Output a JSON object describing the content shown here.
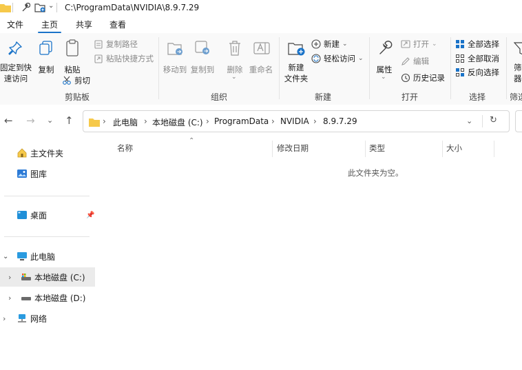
{
  "window": {
    "title": "C:\\ProgramData\\NVIDIA\\8.9.7.29"
  },
  "tabs": [
    {
      "label": "文件"
    },
    {
      "label": "主页"
    },
    {
      "label": "共享"
    },
    {
      "label": "查看"
    }
  ],
  "ribbon": {
    "clipboard": {
      "pin_quick_access": "固定到快\n速访问",
      "copy": "复制",
      "paste": "粘贴",
      "copy_path": "复制路径",
      "paste_shortcut": "粘贴快捷方式",
      "cut": "剪切",
      "group_label": "剪贴板"
    },
    "organize": {
      "move_to": "移动到",
      "copy_to": "复制到",
      "delete": "删除",
      "rename": "重命名",
      "group_label": "组织"
    },
    "new": {
      "new_folder": "新建\n文件夹",
      "new_item": "新建",
      "easy_access": "轻松访问",
      "group_label": "新建"
    },
    "open": {
      "properties": "属性",
      "open": "打开",
      "edit": "编辑",
      "history": "历史记录",
      "group_label": "打开"
    },
    "select": {
      "select_all": "全部选择",
      "select_none": "全部取消",
      "invert_selection": "反向选择",
      "group_label": "选择"
    },
    "filter": {
      "label": "筛\n器",
      "group_label": "筛选"
    }
  },
  "address": {
    "crumbs": [
      "此电脑",
      "本地磁盘 (C:)",
      "ProgramData",
      "NVIDIA",
      "8.9.7.29"
    ]
  },
  "nav_pane": {
    "home": "主文件夹",
    "gallery": "图库",
    "desktop": "桌面",
    "this_pc": "此电脑",
    "drive_c": "本地磁盘 (C:)",
    "drive_d": "本地磁盘 (D:)",
    "network": "网络"
  },
  "list": {
    "columns": [
      "名称",
      "修改日期",
      "类型",
      "大小"
    ],
    "empty_message": "此文件夹为空。"
  },
  "colors": {
    "accent": "#1a73c8",
    "ribbon_bg": "#f9f9f9",
    "selected_bg": "#ebebeb",
    "folder_yellow": "#f6c94a"
  }
}
